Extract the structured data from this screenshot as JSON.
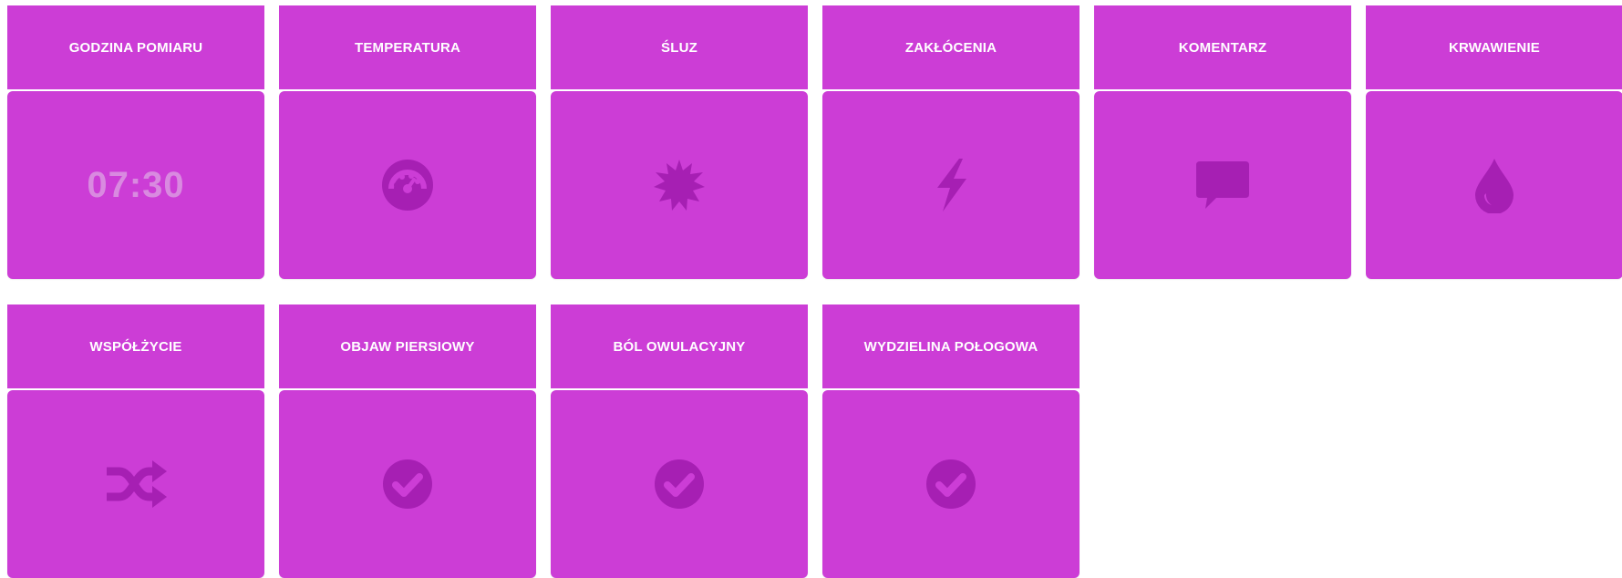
{
  "colors": {
    "tile": "#cc3dd6",
    "icon": "#a61fb3",
    "time_text": "#d98ae0",
    "header_text": "#ffffff"
  },
  "tiles": [
    {
      "label": "GODZINA POMIARU",
      "value": "07:30",
      "icon": ""
    },
    {
      "label": "TEMPERATURA",
      "icon": "dashboard-gauge-icon"
    },
    {
      "label": "ŚLUZ",
      "icon": "certificate-burst-icon"
    },
    {
      "label": "ZAKŁÓCENIA",
      "icon": "bolt-icon"
    },
    {
      "label": "KOMENTARZ",
      "icon": "comment-icon"
    },
    {
      "label": "KRWAWIENIE",
      "icon": "drop-icon"
    },
    {
      "label": "WSPÓŁŻYCIE",
      "icon": "random-shuffle-icon"
    },
    {
      "label": "OBJAW PIERSIOWY",
      "icon": "check-circle-icon"
    },
    {
      "label": "BÓL OWULACYJNY",
      "icon": "check-circle-icon"
    },
    {
      "label": "WYDZIELINA POŁOGOWA",
      "icon": "check-circle-icon"
    }
  ]
}
